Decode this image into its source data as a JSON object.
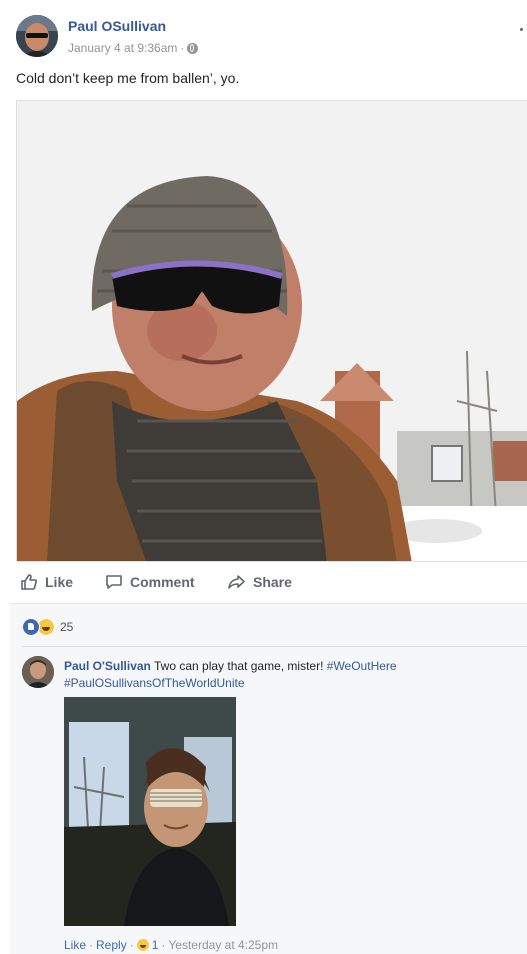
{
  "post": {
    "author": "Paul OSullivan",
    "timestamp": "January 4 at 9:36am",
    "separator": "·",
    "audience_icon": "globe-icon",
    "caption": "Cold don’t keep me from ballen’, yo."
  },
  "actions": {
    "like_label": "Like",
    "comment_label": "Comment",
    "share_label": "Share"
  },
  "reactions": {
    "types": [
      "like",
      "haha"
    ],
    "count": "25"
  },
  "comment": {
    "author": "Paul O'Sullivan",
    "text": "Two can play that game, mister!",
    "hashtag1": "#WeOutHere",
    "hashtag2": "#PaulOSullivansOfTheWorldUnite",
    "like_label": "Like",
    "reply_label": "Reply",
    "reaction_count": "1",
    "time": "Yesterday at 4:25pm",
    "dot": "·"
  },
  "colors": {
    "link_blue": "#365899",
    "action_gray": "#616770",
    "meta_gray": "#90949c",
    "like_blue": "#4267b2",
    "haha_yellow": "#f7c940"
  }
}
